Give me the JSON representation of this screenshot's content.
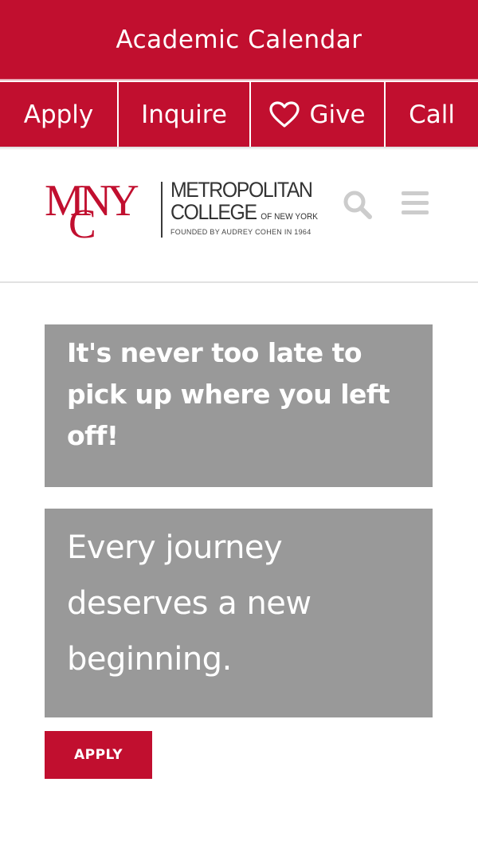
{
  "top_banner": {
    "label": "Academic Calendar"
  },
  "action_bar": {
    "apply": "Apply",
    "inquire": "Inquire",
    "give": "Give",
    "call": "Call"
  },
  "logo": {
    "mark": "MNY",
    "mark_c": "C",
    "name_line1": "METROPOLITAN",
    "name_line2": "COLLEGE",
    "name_suffix": "OF NEW YORK",
    "tagline": "FOUNDED BY AUDREY COHEN IN 1964"
  },
  "header_icons": {
    "search": "search-icon",
    "menu": "hamburger-menu-icon"
  },
  "cards": {
    "headline": "It's never too late to pick up where you left off!",
    "subhead": "Every journey deserves a new beginning."
  },
  "cta": {
    "apply_label": "APPLY"
  },
  "colors": {
    "brand_red": "#c10f2f",
    "card_gray": "#999999",
    "icon_gray": "#cccccc"
  }
}
